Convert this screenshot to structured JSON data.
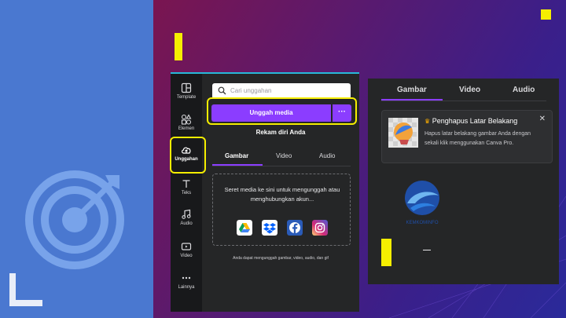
{
  "sidebar": {
    "items": [
      {
        "label": "Template",
        "icon": "template-icon"
      },
      {
        "label": "Elemen",
        "icon": "shapes-icon"
      },
      {
        "label": "Unggahan",
        "icon": "cloud-upload-icon"
      },
      {
        "label": "Teks",
        "icon": "text-icon"
      },
      {
        "label": "Audio",
        "icon": "music-note-icon"
      },
      {
        "label": "Video",
        "icon": "video-icon"
      },
      {
        "label": "Lainnya",
        "icon": "more-dots-icon"
      }
    ]
  },
  "search": {
    "placeholder": "Cari unggahan"
  },
  "actions": {
    "upload_label": "Unggah media",
    "more_label": "···",
    "record_label": "Rekam diri Anda"
  },
  "tabs": [
    "Gambar",
    "Video",
    "Audio"
  ],
  "dropzone": {
    "text": "Seret media ke sini untuk mengunggah atau menghubungkan akun...",
    "sources": [
      "google-drive-icon",
      "dropbox-icon",
      "facebook-icon",
      "instagram-icon"
    ]
  },
  "footnote": "Anda dapat mengunggah gambar, video, audio, dan gif",
  "right_panel": {
    "tabs": [
      "Gambar",
      "Video",
      "Audio"
    ],
    "promo": {
      "title": "Penghapus Latar Belakang",
      "description": "Hapus latar belakang gambar Anda dengan sekali klik menggunakan Canva Pro."
    },
    "logo_caption": "KEMKOMINFO",
    "dash_text": "—"
  },
  "colors": {
    "accent": "#8b3dff",
    "highlight": "#f5ee00",
    "panel_bg": "#252627",
    "left_band": "#4a78d0"
  }
}
